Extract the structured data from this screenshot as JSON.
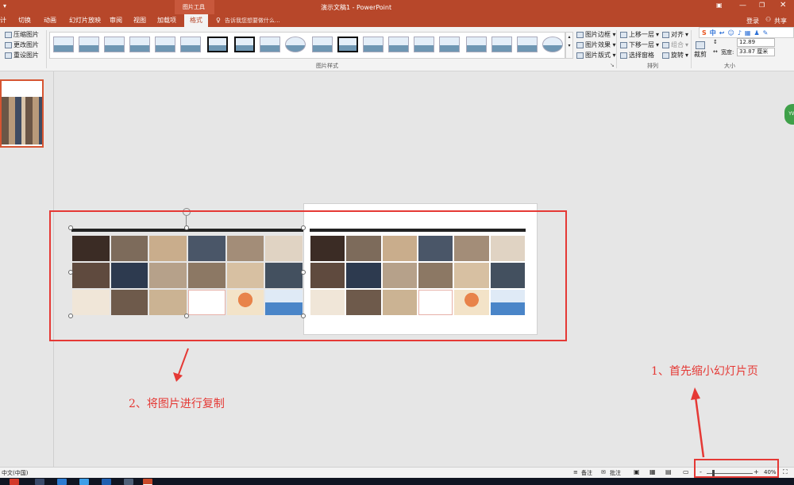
{
  "window": {
    "title": "演示文稿1 - PowerPoint",
    "context_tab_group": "图片工具",
    "login": "登录",
    "share": "共享"
  },
  "tabs": [
    {
      "label": "计"
    },
    {
      "label": "切换"
    },
    {
      "label": "动画"
    },
    {
      "label": "幻灯片放映"
    },
    {
      "label": "审阅"
    },
    {
      "label": "视图"
    },
    {
      "label": "加载项"
    },
    {
      "label": "格式",
      "active": true
    }
  ],
  "tell_me": {
    "placeholder": "告诉我您想要做什么..."
  },
  "ribbon": {
    "adjust": {
      "compress": "压缩图片",
      "change": "更改图片",
      "reset": "重设图片"
    },
    "picture_styles_label": "图片样式",
    "style_options": {
      "border": "图片边框 ▾",
      "effects": "图片效果 ▾",
      "layout": "图片版式 ▾"
    },
    "arrange": {
      "label": "排列",
      "bring_forward": "上移一层",
      "send_backward": "下移一层",
      "selection_pane": "选择窗格",
      "align": "对齐",
      "group": "组合",
      "rotate": "旋转"
    },
    "size": {
      "label": "大小",
      "crop": "裁剪",
      "height_value": "12.89",
      "width_label": "宽度:",
      "width_value": "33.87 厘米"
    }
  },
  "sogou": {
    "s": "S",
    "zh": "中"
  },
  "wechat_badge": "YW",
  "annotations": {
    "step1": "1、首先缩小幻灯片页",
    "step2": "2、将图片进行复制"
  },
  "collage": {
    "tiles": [
      "#3b2c25",
      "#7d6b5b",
      "#c9ad8c",
      "#4a5668",
      "#a38d78",
      "#e0d3c3",
      "#5f4a3e",
      "#2d3a4f",
      "#b6a18a",
      "#8c7864",
      "#d7c0a2",
      "#43505f",
      "#f0e6d8",
      "#6e5a4b",
      "#cbb393",
      "#394559",
      "#a08874",
      "#efe1c4"
    ],
    "accent": "#e8834a",
    "chart_blue": "#4a85c8"
  },
  "status": {
    "language": "中文(中国)",
    "notes": "备注",
    "comments": "批注",
    "zoom": "40%"
  },
  "colors": {
    "accent": "#b7472a",
    "annotation": "#e53935"
  }
}
